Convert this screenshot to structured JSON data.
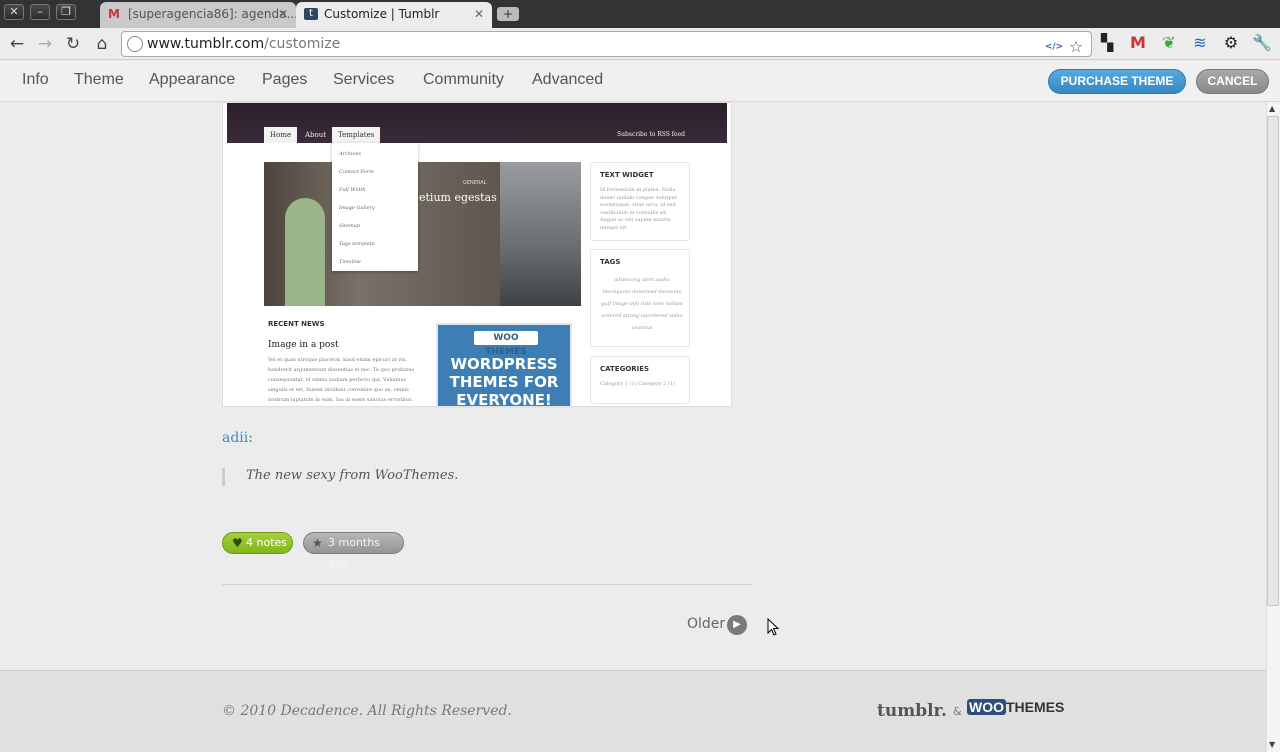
{
  "browser": {
    "tabs": [
      {
        "title": "[superagencia86]: agenda..."
      },
      {
        "title": "Customize | Tumblr"
      }
    ],
    "new_tab": "+",
    "url_domain": "www.tumblr.com",
    "url_path": "/customize"
  },
  "customize_bar": {
    "menu": [
      "Info",
      "Theme",
      "Appearance",
      "Pages",
      "Services",
      "Community",
      "Advanced"
    ],
    "purchase_label": "PURCHASE THEME",
    "cancel_label": "CANCEL"
  },
  "preview": {
    "nav": [
      "Home",
      "About",
      "Templates"
    ],
    "rss": "Subscribe to RSS feed",
    "dropdown": [
      "Archives",
      "Contact Form",
      "Full Width",
      "Image Gallery",
      "Sitemap",
      "Tags template",
      "Timeline"
    ],
    "slide_tag": "GENERAL",
    "slide_title": "etium egestas",
    "widgets": {
      "text_title": "TEXT WIDGET",
      "text_body": "Id fermentum in platea. Nulla donec nullam congue volutpat scelerisque, vitae arcu, id sed vestibulum in convallis sit. Augue ac elit sapien mauris integer sit.",
      "tags_title": "TAGS",
      "tags_body": "adipiscing alert audio blockquote download elements gulf image info lists note nullam ordered strong unordered video vivamus",
      "categories_title": "CATEGORIES",
      "categories_body": "Category 1 (1) Category 2 (1)"
    },
    "recent_news": "RECENT NEWS",
    "post_title": "Image in a post",
    "post_excerpt": "Vel et quas utroque placerat, kasd etiam epicuri at vix, hendrerit argumentum dissentias ei nec. Te quo probatus consequuntur, id omnis audiam perfecto qui. Vukamus singulis et ert, fuisset invidunt convenire quo ex, omnis nostrum luptatum in eum. Ius id esent sanctus erroribus.",
    "woo_logo": "WOO THEMES",
    "woo_text": "WORDPRESS THEMES FOR EVERYONE!"
  },
  "post": {
    "author": "adii",
    "quote": "The new sexy from WooThemes.",
    "notes": "4 notes",
    "time": "3 months ago"
  },
  "pagination": {
    "older": "Older"
  },
  "footer": {
    "copyright": "© 2010 Decadence. All Rights Reserved.",
    "tumblr": "tumblr.",
    "amp": "&",
    "woo_a": "WOO",
    "woo_b": "THEMES"
  }
}
